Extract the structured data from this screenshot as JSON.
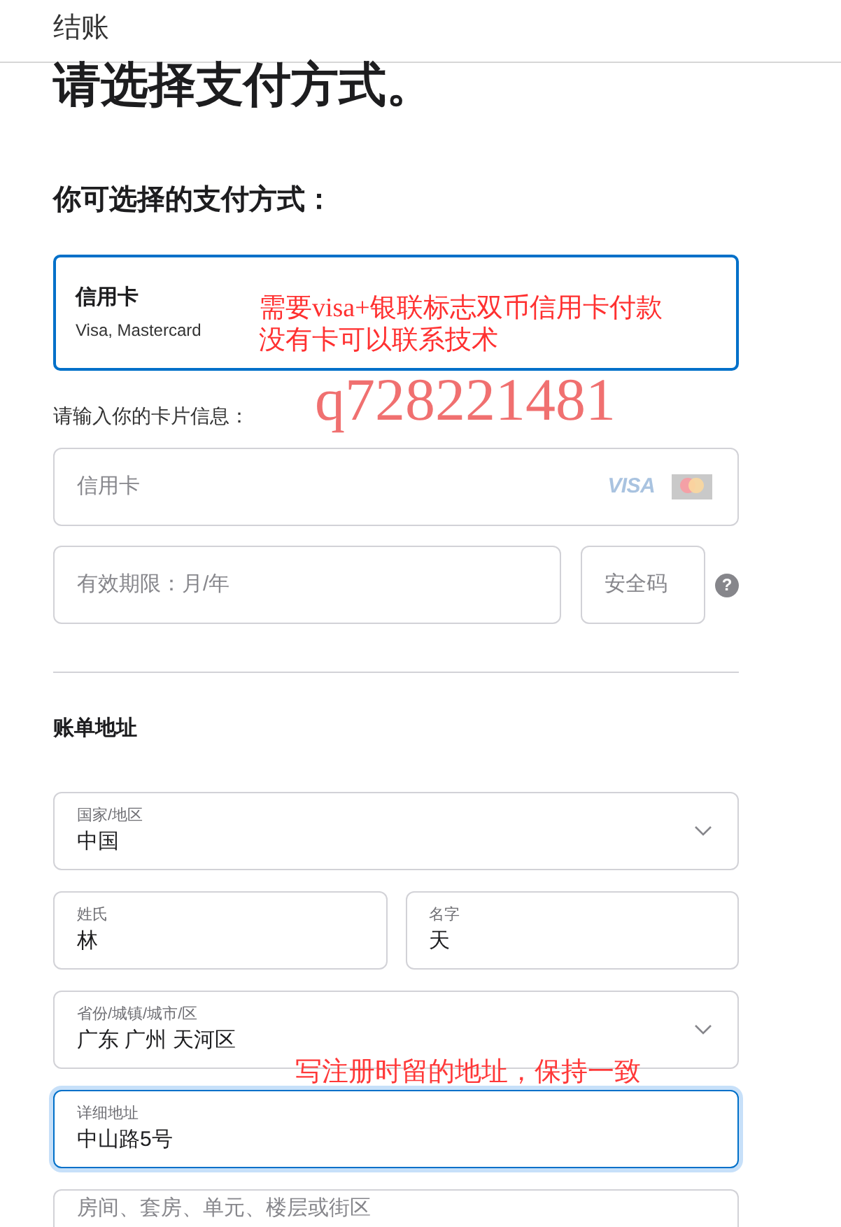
{
  "header": {
    "title": "结账"
  },
  "page_title": "请选择支付方式。",
  "payment_methods": {
    "heading": "你可选择的支付方式：",
    "options": [
      {
        "name": "信用卡",
        "subtitle": "Visa, Mastercard",
        "selected": true
      }
    ]
  },
  "card_info": {
    "label": "请输入你的卡片信息：",
    "rows": [
      [
        {
          "kind": "text",
          "placeholder": "信用卡",
          "focused": false,
          "logos": [
            {
              "kind": "visa",
              "text": "VISA"
            },
            {
              "kind": "mastercard"
            }
          ]
        }
      ],
      [
        {
          "kind": "text",
          "placeholder": "有效期限：月/年",
          "focused": false
        },
        {
          "kind": "text",
          "placeholder": "安全码",
          "focused": false,
          "help": "?"
        }
      ]
    ]
  },
  "billing_address": {
    "heading": "账单地址",
    "rows": [
      [
        {
          "kind": "select",
          "label": "国家/地区",
          "value": "中国",
          "focused": false
        }
      ],
      [
        {
          "kind": "text",
          "label": "姓氏",
          "value": "林",
          "focused": false
        },
        {
          "kind": "text",
          "label": "名字",
          "value": "天",
          "focused": false
        }
      ],
      [
        {
          "kind": "select",
          "label": "省份/城镇/城市/区",
          "value": "广东 广州 天河区",
          "focused": false
        }
      ],
      [
        {
          "kind": "text",
          "label": "详细地址",
          "value": "中山路5号",
          "focused": true
        }
      ],
      [
        {
          "kind": "text",
          "placeholder": "房间、套房、单元、楼层或街区",
          "focused": false
        }
      ]
    ]
  },
  "annotations": [
    {
      "kind": "payment_note",
      "lines": [
        "需要visa+银联标志双币信用卡付款",
        "没有卡可以联系技术"
      ],
      "color": "#ff3030"
    },
    {
      "kind": "contact",
      "lines": [
        "q728221481"
      ],
      "color": "#f07070"
    },
    {
      "kind": "address_note",
      "lines": [
        "写注册时留的地址，保持一致"
      ],
      "color": "#ff3838"
    }
  ]
}
